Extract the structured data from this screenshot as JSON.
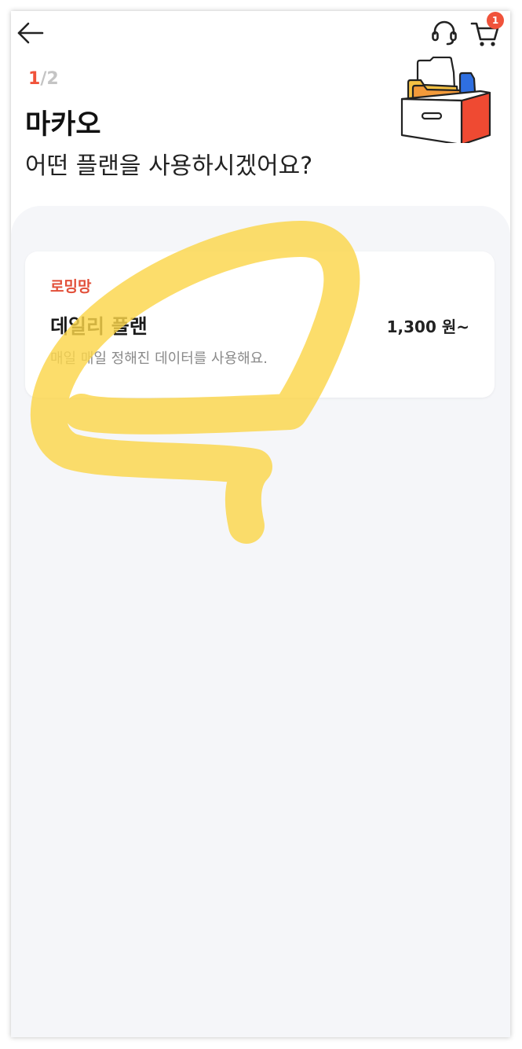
{
  "header": {
    "step_current": "1",
    "step_separator": "/",
    "step_total": "2",
    "carrier": "마카오",
    "question": "어떤 플랜을 사용하시겠어요?",
    "cart_count": "1",
    "icons": {
      "back": "arrow-left-icon",
      "support": "headset-icon",
      "cart": "cart-icon"
    }
  },
  "plans": [
    {
      "tag": "로밍망",
      "name": "데일리 플랜",
      "price": "1,300 원~",
      "description": "매일 매일 정해진 데이터를 사용해요."
    }
  ],
  "colors": {
    "accent": "#f0533b",
    "content_background": "#f5f6f9",
    "marker": "#fbd54a"
  }
}
